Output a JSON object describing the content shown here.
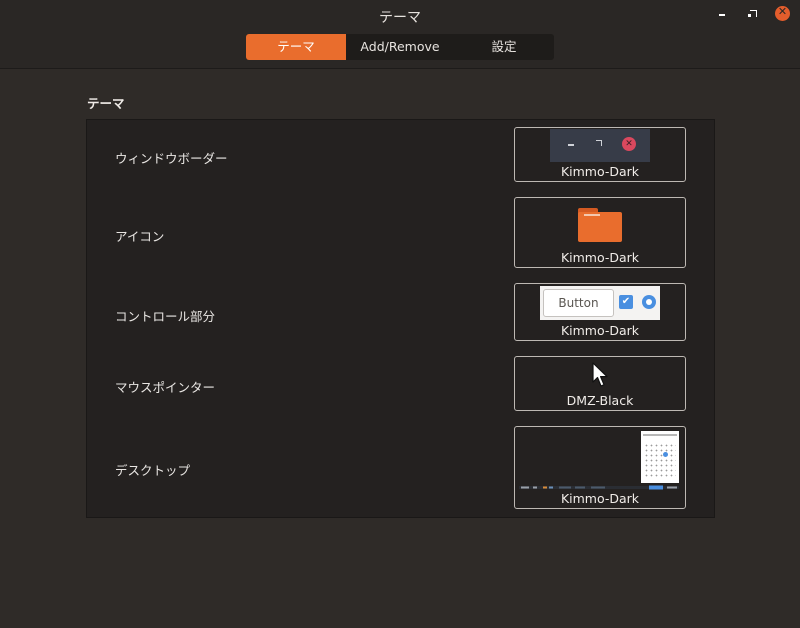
{
  "window": {
    "title": "テーマ"
  },
  "tabs": [
    {
      "label": "テーマ",
      "active": true
    },
    {
      "label": "Add/Remove",
      "active": false
    },
    {
      "label": "設定",
      "active": false
    }
  ],
  "section": {
    "title": "テーマ"
  },
  "rows": [
    {
      "label": "ウィンドウボーダー",
      "value": "Kimmo-Dark",
      "preview": "window-border"
    },
    {
      "label": "アイコン",
      "value": "Kimmo-Dark",
      "preview": "folder-icon"
    },
    {
      "label": "コントロール部分",
      "value": "Kimmo-Dark",
      "preview": "controls",
      "preview_button_label": "Button"
    },
    {
      "label": "マウスポインター",
      "value": "DMZ-Black",
      "preview": "pointer-icon"
    },
    {
      "label": "デスクトップ",
      "value": "Kimmo-Dark",
      "preview": "desktop"
    }
  ],
  "colors": {
    "accent": "#e96d2d",
    "background": "#2f2b28",
    "panel": "#242120",
    "close": "#e45d2c"
  }
}
